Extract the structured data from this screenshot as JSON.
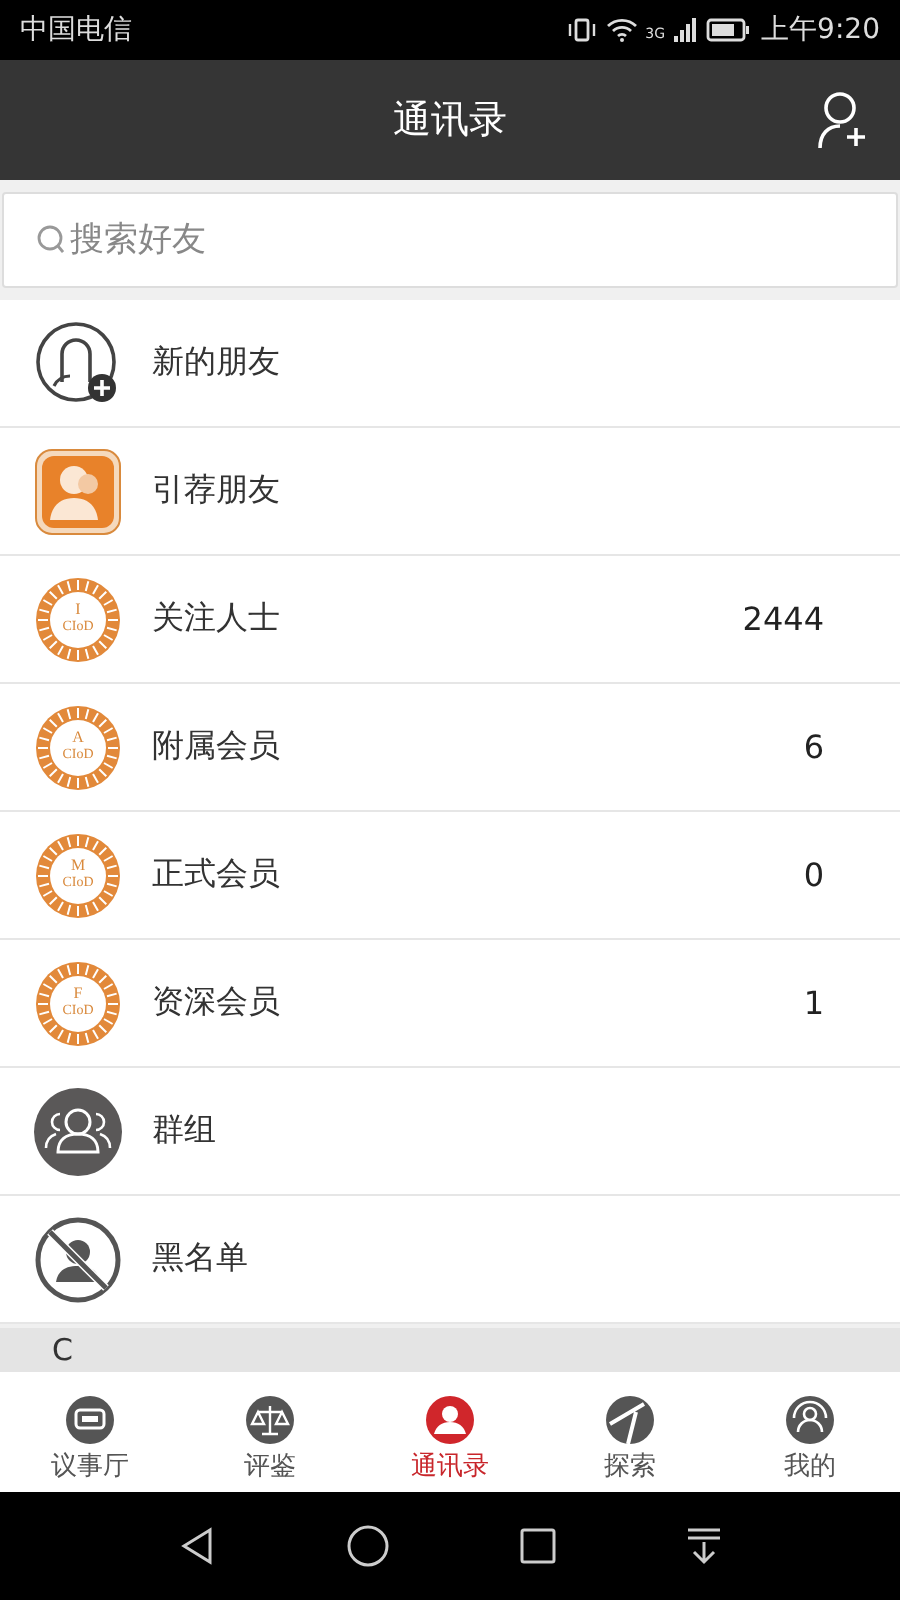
{
  "status_bar": {
    "carrier": "中国电信",
    "network": "3G",
    "time": "上午9:20"
  },
  "header": {
    "title": "通讯录"
  },
  "search": {
    "placeholder": "搜索好友"
  },
  "items": [
    {
      "kind": "new-friend",
      "label": "新的朋友"
    },
    {
      "kind": "recommend",
      "label": "引荐朋友"
    },
    {
      "kind": "badge",
      "label": "关注人士",
      "badge_letter": "I",
      "badge_text": "CIoD",
      "count": "2444"
    },
    {
      "kind": "badge",
      "label": "附属会员",
      "badge_letter": "A",
      "badge_text": "CIoD",
      "count": "6"
    },
    {
      "kind": "badge",
      "label": "正式会员",
      "badge_letter": "M",
      "badge_text": "CIoD",
      "count": "0"
    },
    {
      "kind": "badge",
      "label": "资深会员",
      "badge_letter": "F",
      "badge_text": "CIoD",
      "count": "1"
    },
    {
      "kind": "group",
      "label": "群组"
    },
    {
      "kind": "blacklist",
      "label": "黑名单"
    }
  ],
  "section": {
    "letter": "C"
  },
  "tabs": [
    {
      "kind": "chat",
      "label": "议事厅",
      "selected": false
    },
    {
      "kind": "scale",
      "label": "评鉴",
      "selected": false
    },
    {
      "kind": "contacts",
      "label": "通讯录",
      "selected": true
    },
    {
      "kind": "explore",
      "label": "探索",
      "selected": false
    },
    {
      "kind": "me",
      "label": "我的",
      "selected": false
    }
  ]
}
